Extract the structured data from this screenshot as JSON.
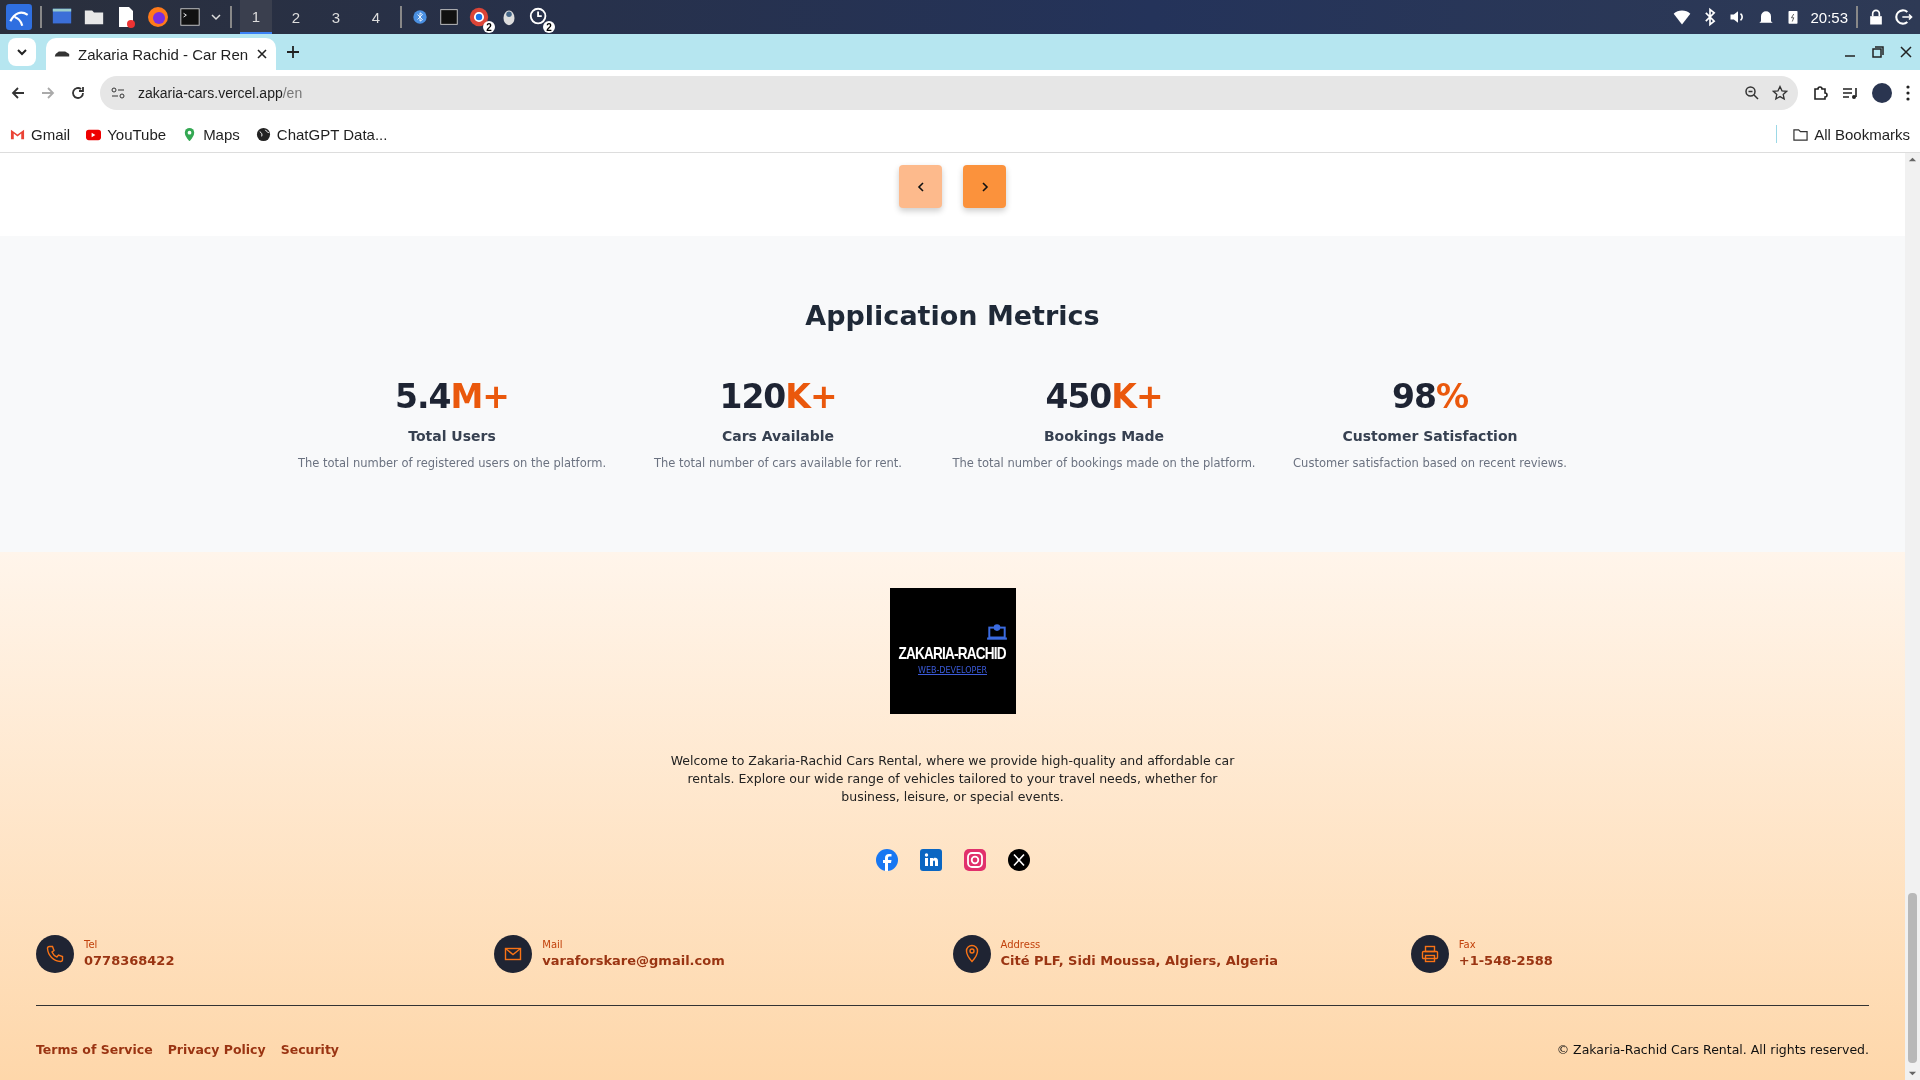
{
  "taskbar": {
    "workspaces": [
      {
        "label": "1",
        "selected": true
      },
      {
        "label": "2",
        "selected": false
      },
      {
        "label": "3",
        "selected": false
      },
      {
        "label": "4",
        "selected": false
      }
    ],
    "badges": [
      "2",
      "2"
    ],
    "clock": "20:53"
  },
  "browser": {
    "tab_title": "Zakaria Rachid - Car Ren",
    "url_host": "zakaria-cars.vercel.app",
    "url_path": "/en",
    "bookmarks": [
      {
        "kind": "gmail",
        "label": "Gmail"
      },
      {
        "kind": "youtube",
        "label": "YouTube"
      },
      {
        "kind": "maps",
        "label": "Maps"
      },
      {
        "kind": "globe",
        "label": "ChatGPT Data..."
      }
    ],
    "all_bookmarks": "All Bookmarks"
  },
  "pager": {
    "buttons": [
      {
        "kind": "prev",
        "disabled": true
      },
      {
        "kind": "next",
        "disabled": false
      }
    ]
  },
  "metrics": {
    "title": "Application Metrics",
    "items": [
      {
        "value": "5.4",
        "suffix": "M+",
        "label": "Total Users",
        "description": "The total number of registered users on the platform."
      },
      {
        "value": "120",
        "suffix": "K+",
        "label": "Cars Available",
        "description": "The total number of cars available for rent."
      },
      {
        "value": "450",
        "suffix": "K+",
        "label": "Bookings Made",
        "description": "The total number of bookings made on the platform."
      },
      {
        "value": "98",
        "suffix": "%",
        "label": "Customer Satisfaction",
        "description": "Customer satisfaction based on recent reviews."
      }
    ]
  },
  "footer": {
    "logo": {
      "name": "ZAKARIA-RACHID",
      "tagline": "WEB-DEVELOPER"
    },
    "about": "Welcome to Zakaria-Rachid Cars Rental, where we provide high-quality and affordable car rentals. Explore our wide range of vehicles tailored to your travel needs, whether for business, leisure, or special events.",
    "socials": [
      {
        "kind": "facebook"
      },
      {
        "kind": "linkedin"
      },
      {
        "kind": "instagram"
      },
      {
        "kind": "x"
      }
    ],
    "contacts": [
      {
        "kind": "phone",
        "label": "Tel",
        "value": "0778368422"
      },
      {
        "kind": "mail",
        "label": "Mail",
        "value": "varaforskare@gmail.com"
      },
      {
        "kind": "pin",
        "label": "Address",
        "value": "Cité PLF, Sidi Moussa, Algiers, Algeria"
      },
      {
        "kind": "printer",
        "label": "Fax",
        "value": "+1-548-2588"
      }
    ],
    "links": [
      "Terms of Service",
      "Privacy Policy",
      "Security"
    ],
    "copyright": "© Zakaria-Rachid Cars Rental. All rights reserved."
  }
}
